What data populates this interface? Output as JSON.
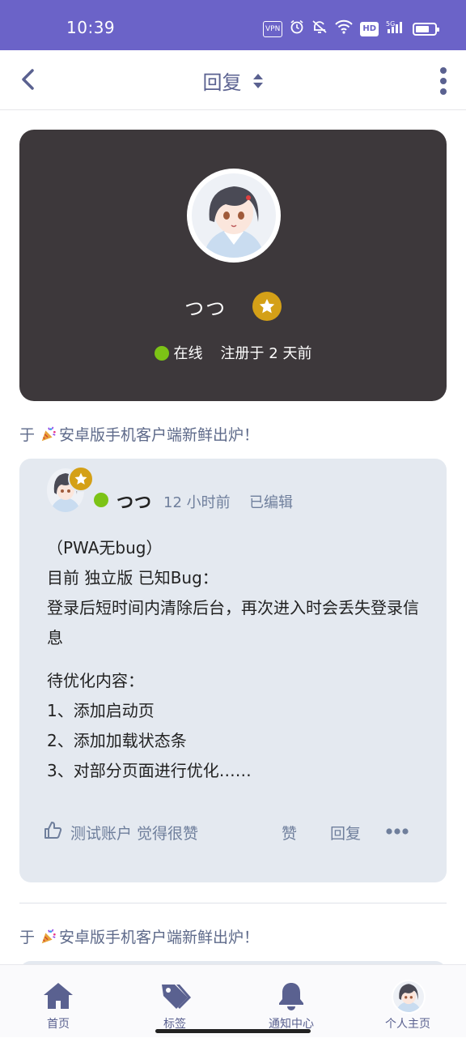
{
  "status_bar": {
    "time": "10:39",
    "vpn_label": "VPN",
    "hd_label": "HD",
    "network_label": "5G",
    "icons": [
      "vpn-icon",
      "alarm-icon",
      "mute-icon",
      "wifi-icon",
      "hd-icon",
      "signal-5g-icon",
      "battery-icon"
    ]
  },
  "header": {
    "title": "回复",
    "back_icon": "chevron-left-icon",
    "sort_icon": "sort-updown-icon",
    "menu_icon": "vertical-dots-icon"
  },
  "profile": {
    "username": "つつ",
    "badge_icon": "star-icon",
    "status": "在线",
    "registered": "注册于 2 天前"
  },
  "thread": {
    "prefix": "于",
    "title": "安卓版手机客户端新鲜出炉！",
    "emoji_icon": "party-popper-icon"
  },
  "post": {
    "author": "つつ",
    "time": "12 小时前",
    "edited": "已编辑",
    "lines": {
      "l1": "（PWA无bug）",
      "l2": "目前 独立版 已知Bug：",
      "l3": "登录后短时间内清除后台，再次进入时会丢失登录信息",
      "l4": "待优化内容：",
      "l5": "1、添加启动页",
      "l6": "2、添加加载状态条",
      "l7": "3、对部分页面进行优化……"
    },
    "liked_by": "测试账户 觉得很赞",
    "like_label": "赞",
    "reply_label": "回复"
  },
  "thread2": {
    "prefix": "于",
    "title": "安卓版手机客户端新鲜出炉！"
  },
  "bottom_nav": {
    "items": [
      {
        "label": "首页",
        "icon": "home-icon"
      },
      {
        "label": "标签",
        "icon": "tags-icon"
      },
      {
        "label": "通知中心",
        "icon": "bell-icon"
      },
      {
        "label": "个人主页",
        "icon": "avatar"
      }
    ]
  },
  "colors": {
    "status_bar": "#6b63c8",
    "accent": "#5a6190",
    "card_dark": "#3d383b",
    "post_bg": "#e4e9f0",
    "online": "#7cc316",
    "badge_gold": "#d4a017"
  }
}
